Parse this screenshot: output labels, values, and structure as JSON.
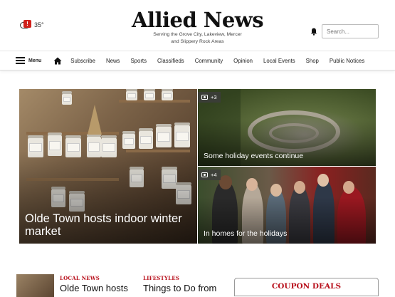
{
  "weather": {
    "temperature": "35°",
    "icon": "cloud-alert-icon",
    "alert_color": "#d0201b"
  },
  "brand": {
    "title": "Allied News",
    "tagline_line1": "Serving the Grove City, Lakeview, Mercer",
    "tagline_line2": "and Slippery Rock Areas"
  },
  "search": {
    "placeholder": "Search..."
  },
  "nav": {
    "menu_label": "Menu",
    "items": [
      "Subscribe",
      "News",
      "Sports",
      "Classifieds",
      "Community",
      "Opinion",
      "Local Events",
      "Shop",
      "Public Notices"
    ]
  },
  "hero": {
    "main": {
      "caption": "Olde Town hosts indoor winter market"
    },
    "top_right": {
      "photo_count": "+3",
      "caption": "Some holiday events continue"
    },
    "bottom_right": {
      "photo_count": "+4",
      "caption": "In homes for the holidays"
    }
  },
  "stories": [
    {
      "section": "LOCAL NEWS",
      "title": "Olde Town hosts"
    },
    {
      "section": "LIFESTYLES",
      "title": "Things to Do from"
    }
  ],
  "coupon": {
    "label": "COUPON DEALS"
  },
  "colors": {
    "accent_red": "#b8101c",
    "text": "#111111"
  }
}
